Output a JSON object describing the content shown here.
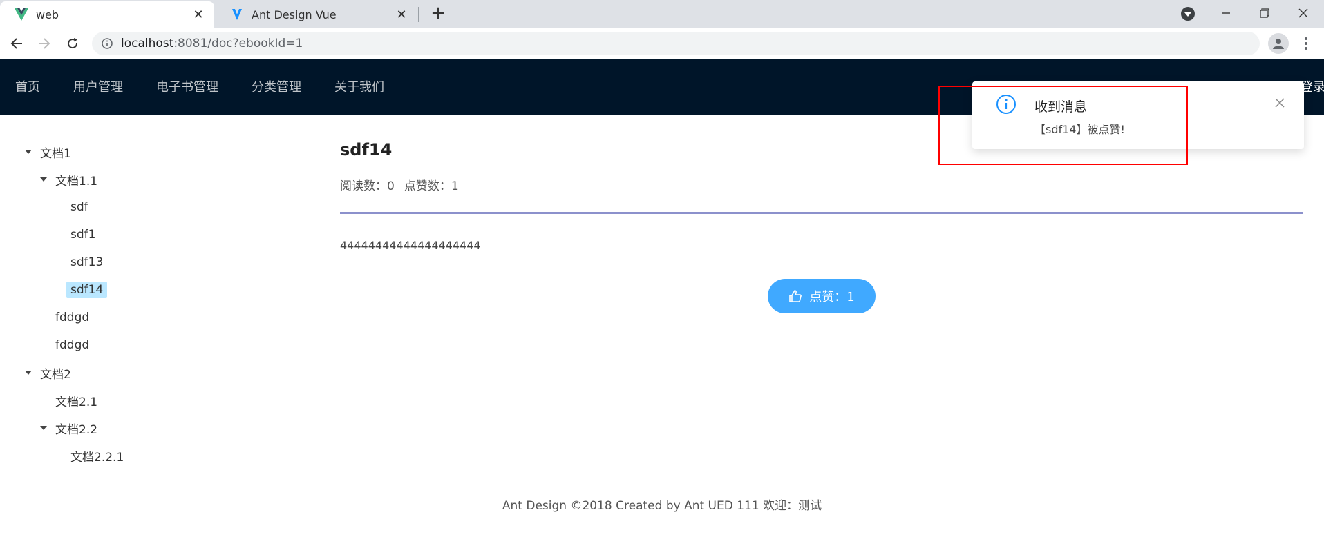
{
  "browser": {
    "tabs": [
      {
        "title": "web",
        "active": true,
        "favicon": "vue-logo-icon"
      },
      {
        "title": "Ant Design Vue",
        "active": false,
        "favicon": "ant-design-logo-icon"
      }
    ],
    "url_host": "localhost",
    "url_rest": ":8081/doc?ebookId=1"
  },
  "header": {
    "menu": [
      "首页",
      "用户管理",
      "电子书管理",
      "分类管理",
      "关于我们"
    ],
    "login_label": "登录"
  },
  "tree": {
    "nodes": [
      {
        "label": "文档1",
        "level": 0,
        "expanded": true
      },
      {
        "label": "文档1.1",
        "level": 1,
        "expanded": true
      },
      {
        "label": "sdf",
        "level": 2
      },
      {
        "label": "sdf1",
        "level": 2
      },
      {
        "label": "sdf13",
        "level": 2
      },
      {
        "label": "sdf14",
        "level": 2,
        "selected": true
      },
      {
        "label": "fddgd",
        "level": 1
      },
      {
        "label": "fddgd",
        "level": 1
      },
      {
        "label": "文档2",
        "level": 0,
        "expanded": true
      },
      {
        "label": "文档2.1",
        "level": 1
      },
      {
        "label": "文档2.2",
        "level": 1,
        "expanded": true
      },
      {
        "label": "文档2.2.1",
        "level": 2
      }
    ]
  },
  "doc": {
    "title": "sdf14",
    "view_count_text": "阅读数：0",
    "vote_count_text": "点赞数：1",
    "content": "44444444444444444444",
    "vote_button_label": "点赞：1"
  },
  "footer": {
    "text": "Ant Design ©2018 Created by Ant UED 111 欢迎：测试"
  },
  "notification": {
    "title": "收到消息",
    "description": "【sdf14】被点赞!"
  },
  "colors": {
    "header_bg": "#001529",
    "primary": "#40a9ff",
    "selected_bg": "#bae7ff",
    "divider": "#8c91cc",
    "annotation_box": "#ff0000"
  }
}
